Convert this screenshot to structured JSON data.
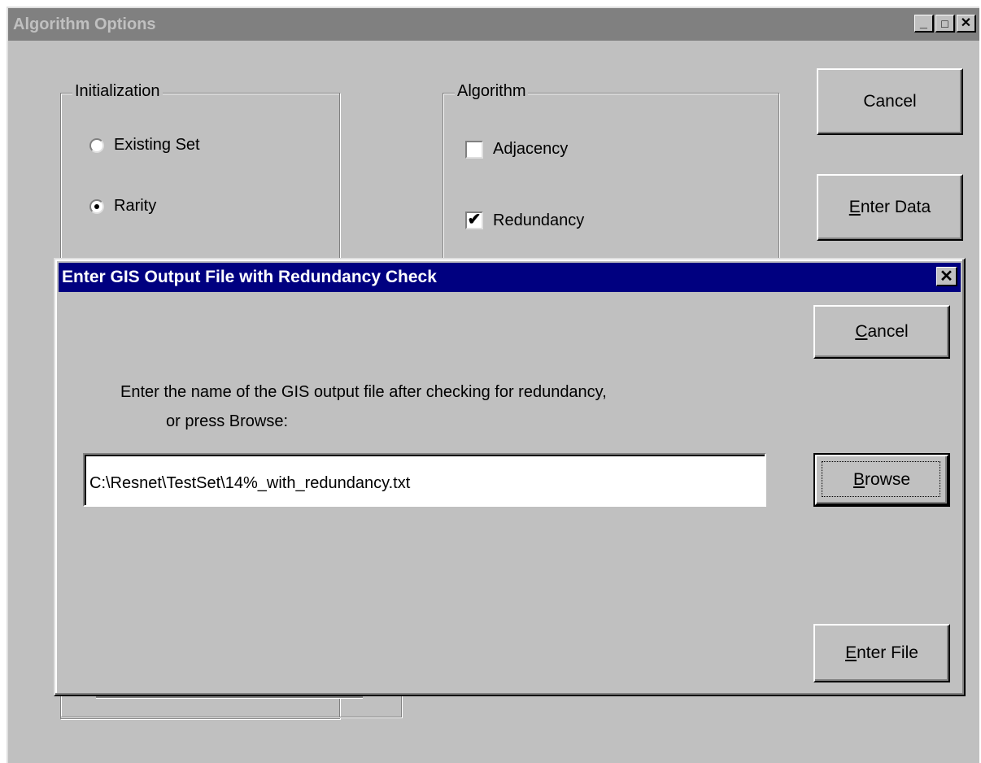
{
  "main_window": {
    "title": "Algorithm Options",
    "titlebar_buttons": {
      "minimize": "_",
      "maximize": "□",
      "close": "✕"
    },
    "initialization_group": {
      "label": "Initialization",
      "options": [
        {
          "label": "Existing Set",
          "selected": false
        },
        {
          "label": "Rarity",
          "selected": true
        }
      ]
    },
    "algorithm_group": {
      "label": "Algorithm",
      "options": [
        {
          "label": "Adjacency",
          "checked": false
        },
        {
          "label": "Redundancy",
          "checked": true
        }
      ]
    },
    "buttons": {
      "cancel": "Cancel",
      "enter_data_mnemonic": "E",
      "enter_data_rest": "nter Data"
    }
  },
  "dialog": {
    "title": "Enter GIS Output File with Redundancy Check",
    "close_glyph": "✕",
    "prompt_line1": "Enter the name of the GIS output file after checking for redundancy,",
    "prompt_line2": "or press Browse:",
    "file_path": "C:\\Resnet\\TestSet\\14%_with_redundancy.txt",
    "buttons": {
      "cancel_mnemonic": "C",
      "cancel_rest": "ancel",
      "browse_mnemonic": "B",
      "browse_rest": "rowse",
      "enter_file_mnemonic": "E",
      "enter_file_rest": "nter File"
    }
  },
  "colors": {
    "face": "#c0c0c0",
    "active_title": "#000080",
    "inactive_title": "#808080"
  }
}
